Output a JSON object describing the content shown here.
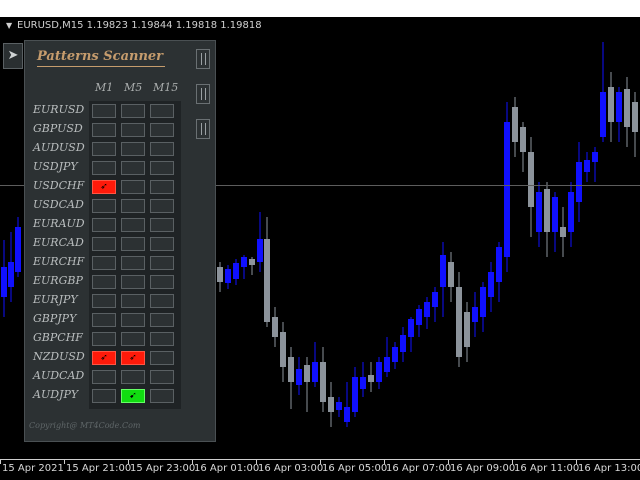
{
  "window": {
    "title": "EURUSD,M15  1.19823 1.19844 1.19818 1.19818",
    "menu_icon": "triangle-down-icon"
  },
  "x_axis_labels": [
    "15 Apr 2021",
    "15 Apr 21:00",
    "15 Apr 23:00",
    "16 Apr 01:00",
    "16 Apr 03:00",
    "16 Apr 05:00",
    "16 Apr 07:00",
    "16 Apr 09:00",
    "16 Apr 11:00",
    "16 Apr 13:00"
  ],
  "scanner": {
    "title": "Patterns Scanner",
    "columns": [
      "M1",
      "M5",
      "M15"
    ],
    "copyright": "Copyright@ MT4Code.Com",
    "collapse_icon": "arrow-icon",
    "rows": [
      {
        "symbol": "EURUSD",
        "cells": [
          "",
          "",
          ""
        ]
      },
      {
        "symbol": "GBPUSD",
        "cells": [
          "",
          "",
          ""
        ]
      },
      {
        "symbol": "AUDUSD",
        "cells": [
          "",
          "",
          ""
        ]
      },
      {
        "symbol": "USDJPY",
        "cells": [
          "",
          "",
          ""
        ]
      },
      {
        "symbol": "USDCHF",
        "cells": [
          "sell",
          "",
          ""
        ]
      },
      {
        "symbol": "USDCAD",
        "cells": [
          "",
          "",
          ""
        ]
      },
      {
        "symbol": "EURAUD",
        "cells": [
          "",
          "",
          ""
        ]
      },
      {
        "symbol": "EURCAD",
        "cells": [
          "",
          "",
          ""
        ]
      },
      {
        "symbol": "EURCHF",
        "cells": [
          "",
          "",
          ""
        ]
      },
      {
        "symbol": "EURGBP",
        "cells": [
          "",
          "",
          ""
        ]
      },
      {
        "symbol": "EURJPY",
        "cells": [
          "",
          "",
          ""
        ]
      },
      {
        "symbol": "GBPJPY",
        "cells": [
          "",
          "",
          ""
        ]
      },
      {
        "symbol": "GBPCHF",
        "cells": [
          "",
          "",
          ""
        ]
      },
      {
        "symbol": "NZDUSD",
        "cells": [
          "sell",
          "sell",
          ""
        ]
      },
      {
        "symbol": "AUDCAD",
        "cells": [
          "",
          "",
          ""
        ]
      },
      {
        "symbol": "AUDJPY",
        "cells": [
          "",
          "buy",
          ""
        ]
      }
    ]
  },
  "colors": {
    "bull": "#1010ff",
    "bear": "#8c939b",
    "sell_signal": "#ff1a0a",
    "buy_signal": "#11dd11",
    "panel_bg": "#2c3133",
    "title_accent": "#c69c6d"
  }
}
